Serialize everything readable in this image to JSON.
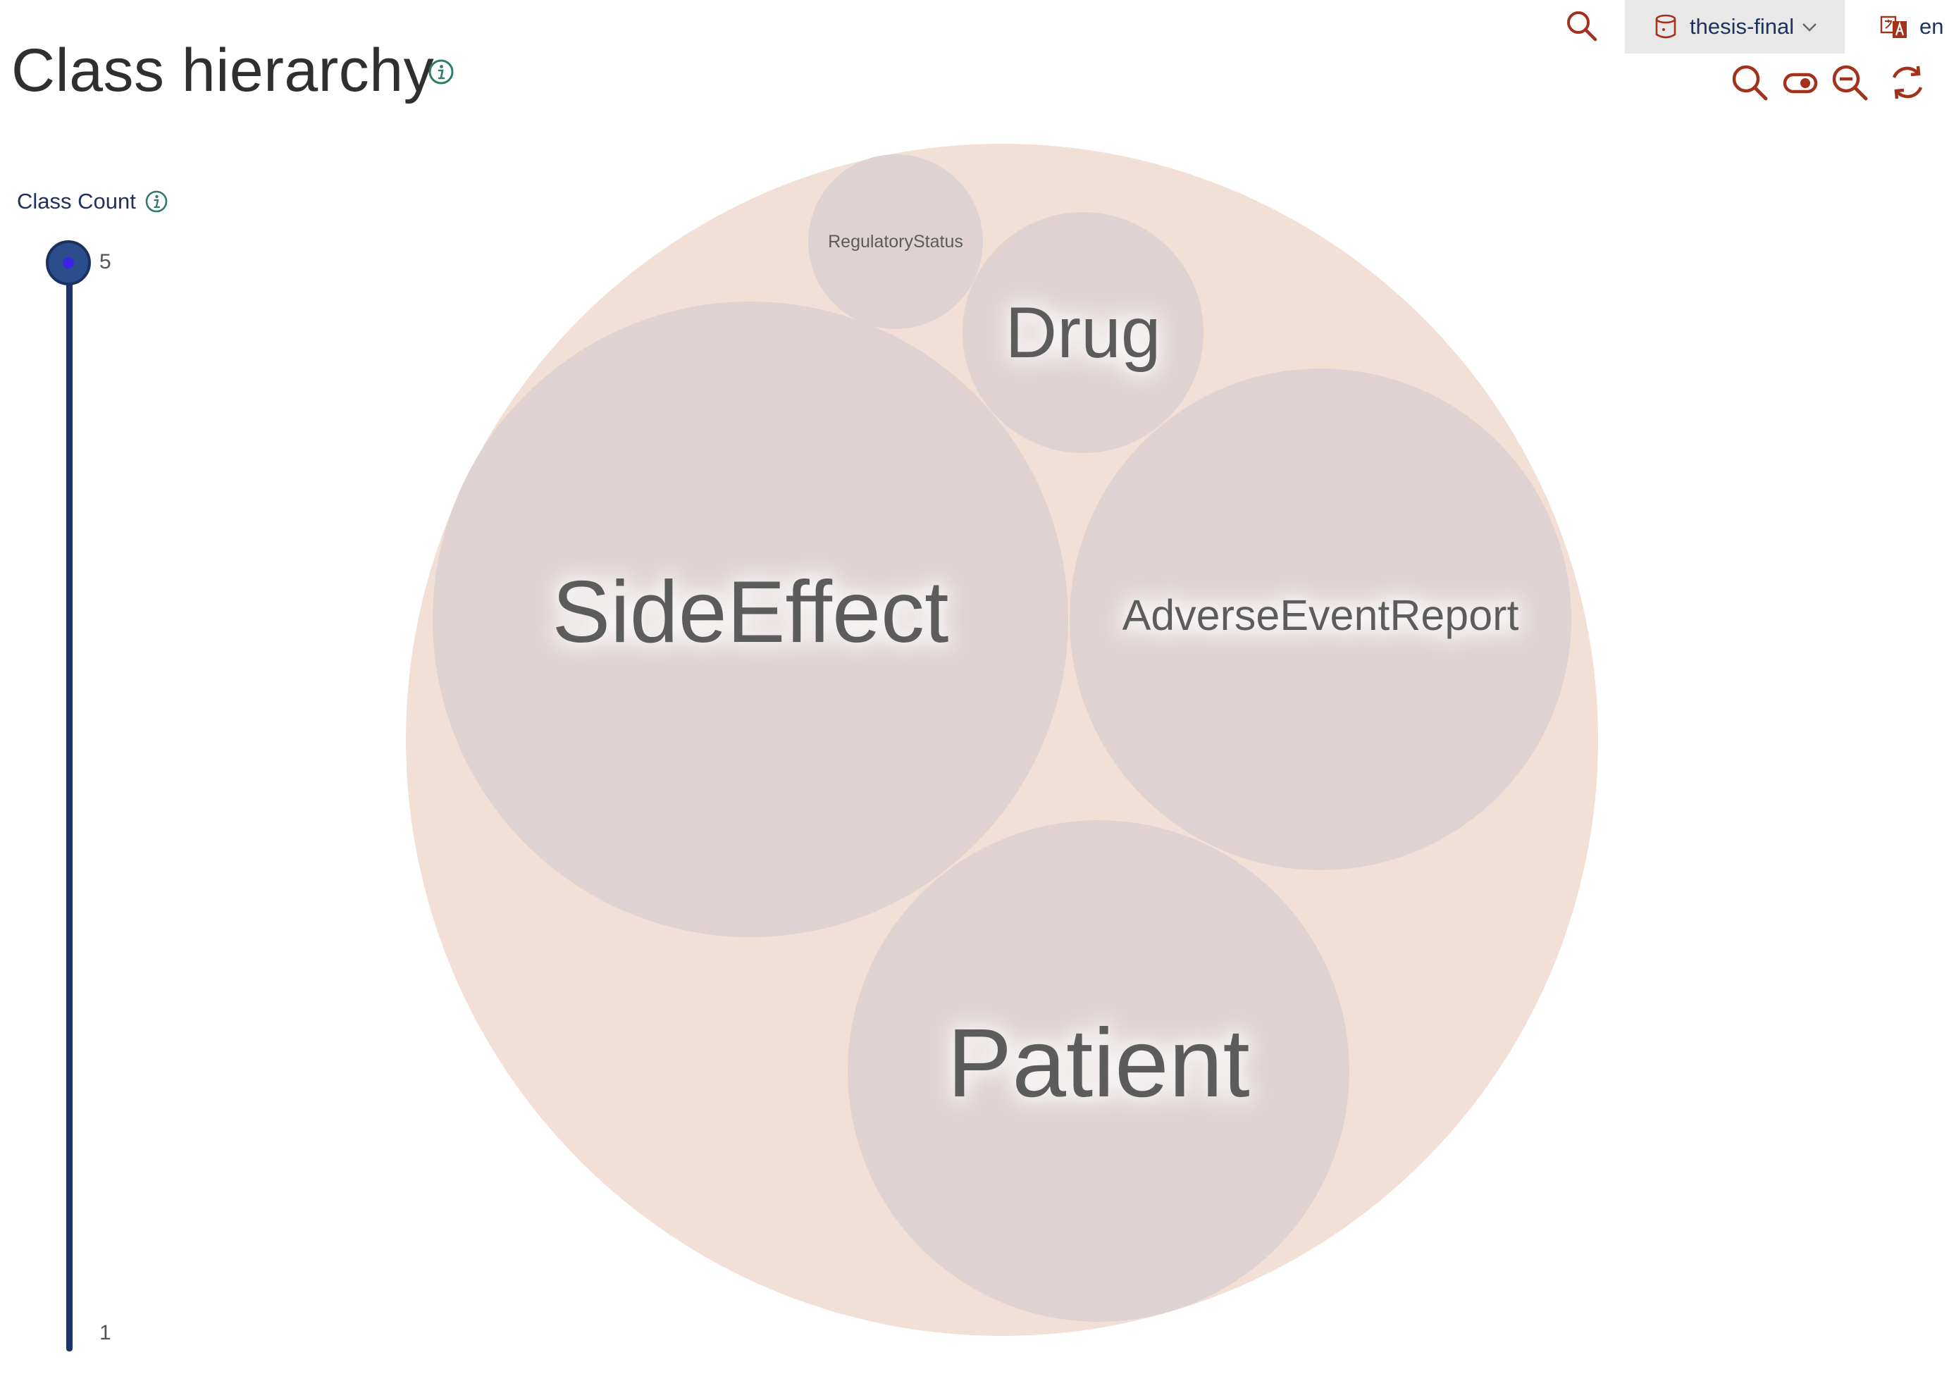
{
  "header": {
    "title": "Class hierarchy",
    "repository": "thesis-final",
    "language": "en"
  },
  "icons": {
    "title_info": "info-icon",
    "search": "search-icon",
    "repository": "database-icon",
    "repository_dropdown": "chevron-down-icon",
    "language": "translate-icon",
    "focus_search": "search-icon",
    "toggle_labels": "toggle-icon",
    "zoom_out": "zoom-out-icon",
    "reset": "refresh-icon"
  },
  "sidebar": {
    "class_count_label": "Class Count",
    "slider_max": "5",
    "slider_min": "1",
    "slider_value": 5
  },
  "hierarchy": {
    "classes": [
      {
        "label": "RegulatoryStatus"
      },
      {
        "label": "Drug"
      },
      {
        "label": "SideEffect"
      },
      {
        "label": "AdverseEventReport"
      },
      {
        "label": "Patient"
      }
    ]
  },
  "colors": {
    "accent_icons": "#a2321b",
    "root_circle": "#f2dfd5",
    "class_circle": "#ded3d2",
    "slider": "#1d3566",
    "slider_thumb_dot": "#3c23e6",
    "label_text": "#5b5b5b",
    "info_icon": "#2e7b6a"
  }
}
